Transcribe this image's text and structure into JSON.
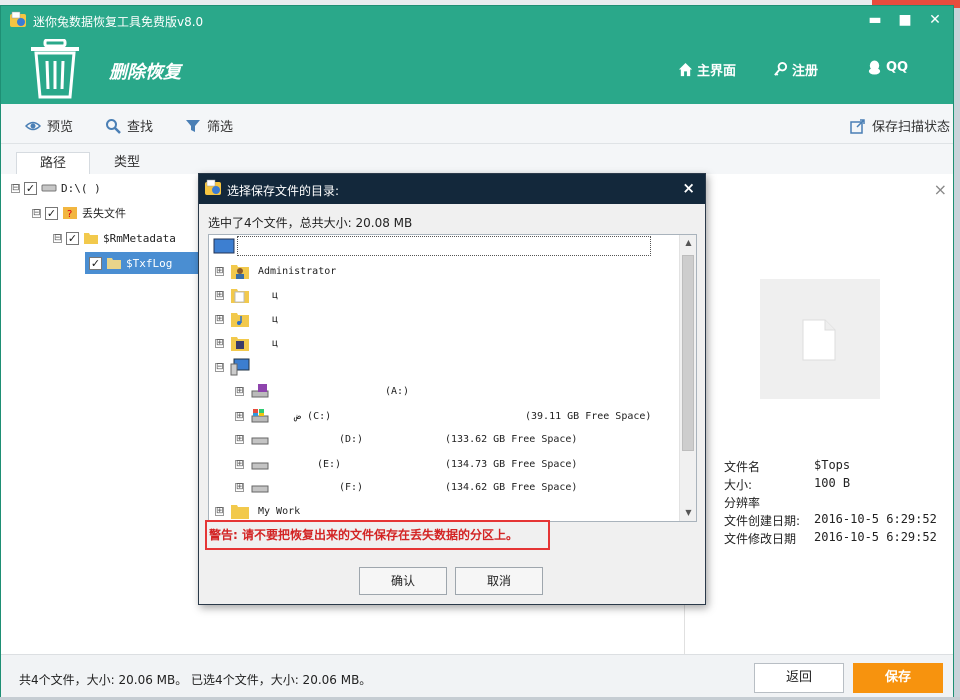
{
  "app": {
    "title": "迷你兔数据恢复工具免费版v8.0",
    "module_title": "删除恢复",
    "window_buttons": {
      "min": "▬",
      "max": "■",
      "close": "✕"
    }
  },
  "header": {
    "nav": [
      {
        "label": "主界面",
        "icon": "home-icon"
      },
      {
        "label": "注册",
        "icon": "key-icon"
      },
      {
        "label": "QQ",
        "icon": "qq-penguin-icon"
      }
    ]
  },
  "toolbar": {
    "preview": "预览",
    "find": "查找",
    "filter": "筛选",
    "save_scan": "保存扫描状态"
  },
  "tabs": [
    "路径",
    "类型"
  ],
  "tree": [
    {
      "label": "D:\\(        )",
      "exp": "⊟",
      "checked": "✓",
      "icon": "drive-icon"
    },
    {
      "label": "丢失文件",
      "exp": "⊟",
      "checked": "✓",
      "icon": "lost-files-icon"
    },
    {
      "label": "$RmMetadata",
      "exp": "⊟",
      "checked": "✓",
      "icon": "folder-icon"
    },
    {
      "label": "$TxfLog",
      "exp": "",
      "checked": "✓",
      "icon": "folder-icon"
    }
  ],
  "right_panel": {
    "close": "×",
    "info": [
      {
        "k": "文件名",
        "v": "$Tops"
      },
      {
        "k": "大小:",
        "v": "100 B"
      },
      {
        "k": "分辨率",
        "v": ""
      },
      {
        "k": "文件创建日期:",
        "v": "2016-10-5 6:29:52"
      },
      {
        "k": "文件修改日期",
        "v": "2016-10-5 6:29:52"
      }
    ]
  },
  "status": {
    "text": "共4个文件，大小: 20.06 MB。 已选4个文件，大小: 20.06 MB。",
    "back": "返回",
    "save": "保存"
  },
  "dialog": {
    "title": "选择保存文件的目录:",
    "close": "×",
    "summary": "选中了4个文件，总共大小: 20.08 MB",
    "rows": [
      {
        "exp": "⊞",
        "name": "Administrator",
        "extra": "",
        "icon": "user-folder-icon"
      },
      {
        "exp": "⊞",
        "name": "ц",
        "extra": "",
        "icon": "folder-icon"
      },
      {
        "exp": "⊞",
        "name": "ц",
        "extra": "",
        "icon": "music-folder-icon"
      },
      {
        "exp": "⊞",
        "name": "ц",
        "extra": "",
        "icon": "video-folder-icon"
      },
      {
        "exp": "⊟",
        "name": "",
        "extra": "",
        "icon": "computer-icon"
      },
      {
        "exp": "⊞",
        "name": "(A:)",
        "extra": "",
        "icon": "floppy-drive-icon"
      },
      {
        "exp": "⊞",
        "name": "ض        (C:)",
        "extra": "(39.11 GB Free Space)",
        "icon": "windows-drive-icon"
      },
      {
        "exp": "⊞",
        "name": "(D:)",
        "extra": "(133.62 GB Free Space)",
        "icon": "drive-icon"
      },
      {
        "exp": "⊞",
        "name": "(E:)",
        "extra": "(134.73 GB Free Space)",
        "icon": "drive-icon"
      },
      {
        "exp": "⊞",
        "name": "(F:)",
        "extra": "(134.62 GB Free Space)",
        "icon": "drive-icon"
      },
      {
        "exp": "⊞",
        "name": "My Work",
        "extra": "",
        "icon": "folder-icon"
      }
    ],
    "scroll_up": "▲",
    "scroll_down": "▼",
    "warning": "警告: 请不要把恢复出来的文件保存在丢失数据的分区上。",
    "ok": "确认",
    "cancel": "取消"
  }
}
